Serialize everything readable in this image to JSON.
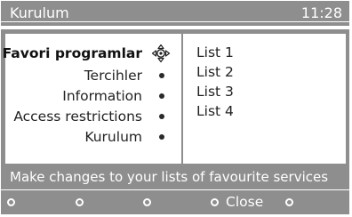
{
  "header": {
    "title": "Kurulum",
    "clock": "11:28"
  },
  "menu": {
    "items": [
      {
        "label": "Favori programlar",
        "selected": true,
        "icon": "navigation-cross-icon"
      },
      {
        "label": "Tercihler",
        "selected": false,
        "icon": "dot-icon"
      },
      {
        "label": "Information",
        "selected": false,
        "icon": "dot-icon"
      },
      {
        "label": "Access restrictions",
        "selected": false,
        "icon": "dot-icon"
      },
      {
        "label": "Kurulum",
        "selected": false,
        "icon": "dot-icon"
      }
    ]
  },
  "lists": {
    "items": [
      "List 1",
      "List 2",
      "List 3",
      "List 4"
    ]
  },
  "footer": {
    "hint": "Make changes to your lists of favourite services",
    "softkeys": [
      {
        "label": "",
        "icon": "circle-icon"
      },
      {
        "label": "",
        "icon": "circle-icon"
      },
      {
        "label": "",
        "icon": "circle-icon"
      },
      {
        "label": "Close",
        "icon": "circle-icon"
      },
      {
        "label": "",
        "icon": "circle-icon"
      }
    ]
  },
  "colors": {
    "panel_gray": "#8e8e8e",
    "content_white": "#ffffff",
    "text_dark": "#222222"
  }
}
